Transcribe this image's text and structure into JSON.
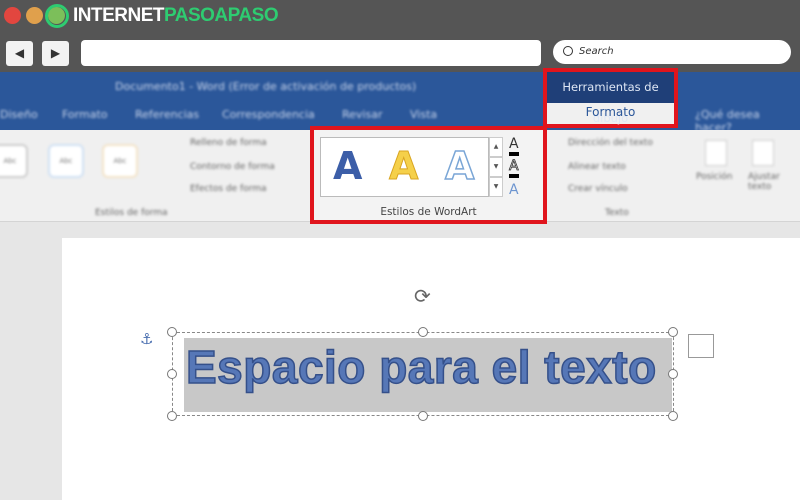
{
  "browser": {
    "logo_text_1": "INTERNET",
    "logo_text_2": "PASOAPASO",
    "back": "◀",
    "forward": "▶",
    "search_placeholder": "Search",
    "colors": {
      "close": "#e2463f",
      "min": "#e0a04c",
      "max": "#7cbf5a",
      "logo_green": "#2ecc71"
    }
  },
  "word": {
    "title": "Documento1 - Word (Error de activación de productos)",
    "tabs": [
      "Diseño",
      "Formato",
      "Referencias",
      "Correspondencia",
      "Revisar",
      "Vista"
    ],
    "tell_me": "¿Qué desea hacer?",
    "contextual_group": "Herramientas de dibujo",
    "contextual_tab": "Formato",
    "shape_styles": {
      "items": [
        "Relleno de forma",
        "Contorno de forma",
        "Efectos de forma"
      ],
      "label": "Estilos de forma",
      "presets": [
        "Abc",
        "Abc",
        "Abc"
      ]
    },
    "wordart": {
      "label": "Estilos de WordArt",
      "gallery": [
        "A",
        "A",
        "A"
      ],
      "text_fill": "A",
      "text_outline": "A",
      "text_effects": "A"
    },
    "text_group": {
      "items": [
        "Dirección del texto",
        "Alinear texto",
        "Crear vínculo"
      ],
      "label": "Texto"
    },
    "arrange": {
      "position": "Posición",
      "wrap": "Ajustar texto"
    },
    "brand_color": "#2b579a",
    "highlight_color": "#e0151d"
  },
  "document": {
    "textbox_text": "Espacio para el texto",
    "anchor_icon": "⚓",
    "rotate_icon": "⟳"
  }
}
